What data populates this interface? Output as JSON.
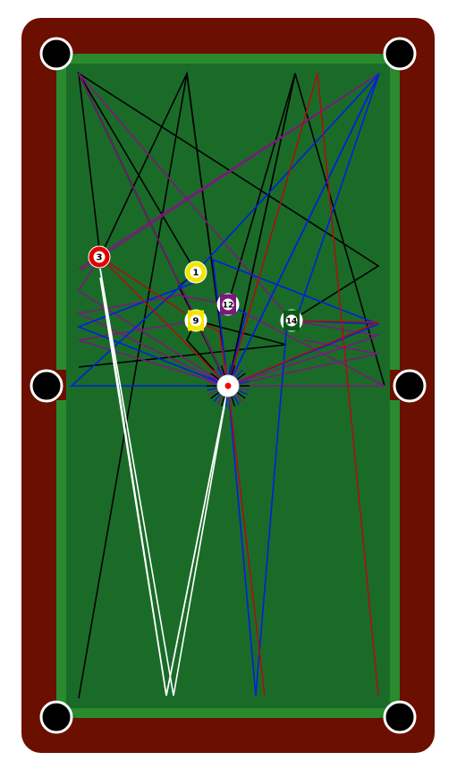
{
  "colors": {
    "rail": "#6b0f00",
    "cushion": "#2a8a2e",
    "cloth": "#1a6b28",
    "pocket": "#000000",
    "pocket_ring": "#ffffff",
    "cue_ball": "#ffffff",
    "cue_dot": "#ff0000",
    "shot_black": "#000000",
    "shot_purple": "#7a1a7a",
    "shot_blue": "#0022dd",
    "shot_red": "#aa1111",
    "shot_white": "#ffffff"
  },
  "balls": [
    {
      "id": "ball-3",
      "number": "3",
      "color": "#e00000",
      "stripe": false
    },
    {
      "id": "ball-1",
      "number": "1",
      "color": "#f2e600",
      "stripe": false
    },
    {
      "id": "ball-12",
      "number": "12",
      "color": "#7a1a7a",
      "stripe": true
    },
    {
      "id": "ball-9",
      "number": "9",
      "color": "#f2e600",
      "stripe": true
    },
    {
      "id": "ball-14",
      "number": "14",
      "color": "#0a5a1a",
      "stripe": true
    }
  ]
}
